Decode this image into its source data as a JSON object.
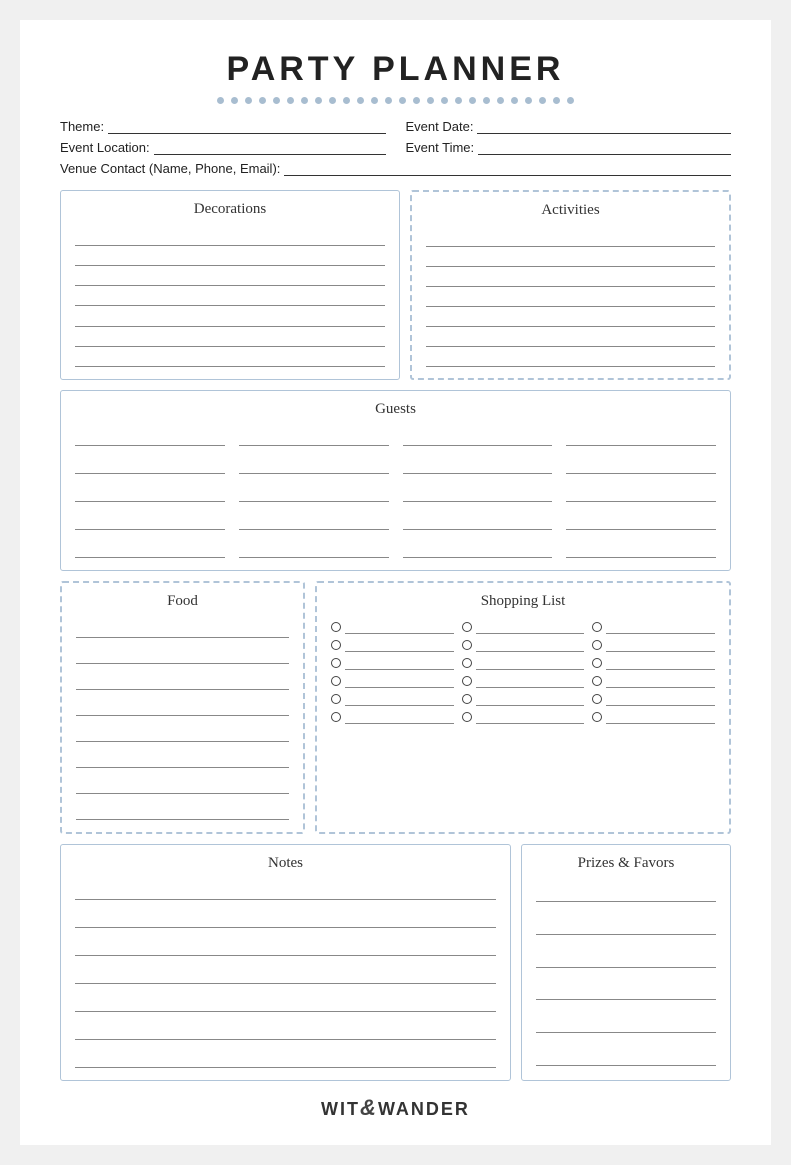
{
  "title": "PARTY PLANNER",
  "fields": {
    "theme_label": "Theme:",
    "event_date_label": "Event Date:",
    "event_location_label": "Event Location:",
    "event_time_label": "Event Time:",
    "venue_contact_label": "Venue Contact (Name, Phone, Email):"
  },
  "sections": {
    "decorations": "Decorations",
    "activities": "Activities",
    "guests": "Guests",
    "food": "Food",
    "shopping_list": "Shopping List",
    "notes": "Notes",
    "prizes_favors": "Prizes & Favors"
  },
  "footer": {
    "text1": "WIT",
    "ampersand": "&",
    "text2": "WANDER"
  },
  "dots": 26
}
